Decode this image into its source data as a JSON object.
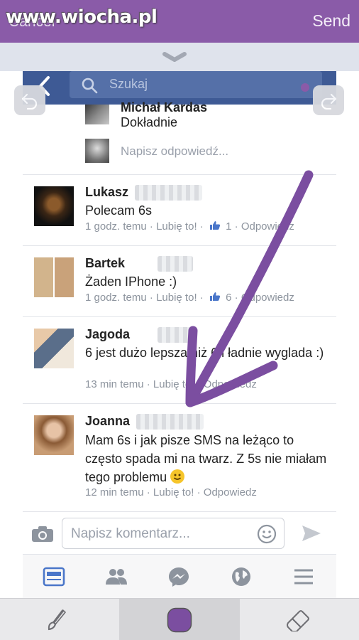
{
  "editor": {
    "cancel_label": "Cancel",
    "send_label": "Send",
    "watermark": "www.wiocha.pl",
    "ink_color": "#7b4ea0"
  },
  "search": {
    "placeholder": "Szukaj"
  },
  "thread_reply": {
    "name": "Michał Kardas",
    "text": "Dokładnie",
    "reply_placeholder": "Napisz odpowiedź..."
  },
  "comments": [
    {
      "name": "Lukasz",
      "text": "Polecam 6s",
      "time": "1 godz. temu",
      "like_label": "Lubię to!",
      "like_count": "1",
      "reply_label": "Odpowiedz"
    },
    {
      "name": "Bartek",
      "text": "Żaden IPhone :)",
      "time": "1 godz. temu",
      "like_label": "Lubię to!",
      "like_count": "6",
      "reply_label": "Odpowiedz"
    },
    {
      "name": "Jagoda",
      "text": "6 jest dużo lepsza niż 6 i ładnie wyglada :)",
      "time": "13 min temu",
      "like_label": "Lubię to!",
      "reply_label": "Odpowiedz"
    },
    {
      "name": "Joanna",
      "text": "Mam 6s i jak pisze SMS na leżąco to często spada mi na twarz. Z 5s nie miałam tego problemu",
      "time": "12 min temu",
      "like_label": "Lubię to!",
      "reply_label": "Odpowiedz"
    }
  ],
  "composer": {
    "placeholder": "Napisz komentarz..."
  },
  "colors": {
    "purple": "#8a5ba8",
    "fb_blue": "#3e5a95",
    "link_blue": "#4a76c9"
  }
}
